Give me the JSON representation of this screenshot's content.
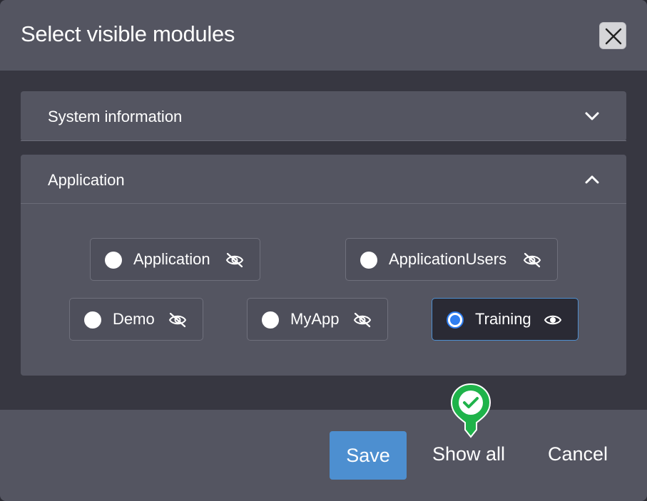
{
  "dialog": {
    "title": "Select visible modules",
    "close_icon": "close-icon"
  },
  "sections": [
    {
      "title": "System information",
      "expanded": false,
      "icon": "chevron-down-icon"
    },
    {
      "title": "Application",
      "expanded": true,
      "icon": "chevron-up-icon"
    }
  ],
  "modules": [
    {
      "label": "Application",
      "selected": false,
      "visibility_icon": "eye-off-icon"
    },
    {
      "label": "ApplicationUsers",
      "selected": false,
      "visibility_icon": "eye-off-icon"
    },
    {
      "label": "Demo",
      "selected": false,
      "visibility_icon": "eye-off-icon"
    },
    {
      "label": "MyApp",
      "selected": false,
      "visibility_icon": "eye-off-icon"
    },
    {
      "label": "Training",
      "selected": true,
      "visibility_icon": "eye-icon"
    }
  ],
  "footer": {
    "save_label": "Save",
    "show_all_label": "Show all",
    "cancel_label": "Cancel"
  },
  "colors": {
    "accent": "#4d8fd0",
    "radio_selected": "#2f7ef0",
    "marker_green": "#1fb34a"
  }
}
